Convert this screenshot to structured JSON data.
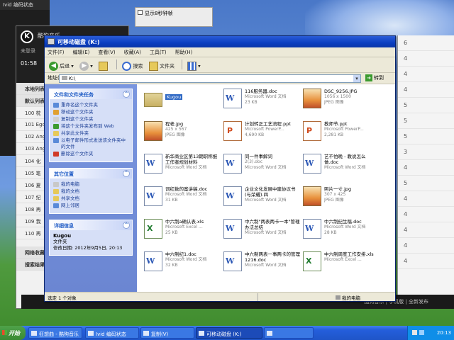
{
  "background": {
    "top_window_title": "Ivid 编码状态",
    "checkbox_label": "显示8秒钟帧",
    "music_app": {
      "title": "酷狗音乐",
      "user": "未登录",
      "time": "01:58",
      "rows": [
        "本地列表",
        "默认列表",
        "100 枕",
        "101 Ego",
        "102 Ang",
        "103 Ang",
        "104 化",
        "105 笔",
        "106 夏",
        "107 纪",
        "108 再",
        "109 我",
        "110 再"
      ],
      "footer_rows": [
        "网络收藏",
        "搜索结果"
      ]
    },
    "right_list": [
      "6",
      "4",
      "4",
      "4",
      "5",
      "5",
      "5",
      "3",
      "4",
      "5",
      "4",
      "4",
      "4",
      "4",
      "4"
    ],
    "strip_text": "酷狗音乐 | 手机版 | 全新发布"
  },
  "window": {
    "title": "可移动磁盘 (K:)",
    "menu": [
      "文件(F)",
      "编辑(E)",
      "查看(V)",
      "收藏(A)",
      "工具(T)",
      "帮助(H)"
    ],
    "toolbar": {
      "back": "后退",
      "search": "搜索",
      "folders": "文件夹"
    },
    "address": {
      "label": "地址(D)",
      "value": "K:\\",
      "go": "转到"
    },
    "tasks_panel": {
      "title": "文件和文件夹任务",
      "items": [
        "重命名这个文件夹",
        "移动这个文件夹",
        "复制这个文件夹",
        "将这个文件夹发布到 Web",
        "共享此文件夹",
        "以电子邮件形式发送该文件夹中的文件",
        "删除这个文件夹"
      ]
    },
    "places_panel": {
      "title": "其它位置",
      "items": [
        "我的电脑",
        "我的文档",
        "共享文档",
        "网上邻居"
      ]
    },
    "details_panel": {
      "title": "详细信息",
      "name": "Kugou",
      "type": "文件夹",
      "modified": "修改日期: 2012年9月5日, 20:13"
    },
    "files": [
      {
        "name": "Kugou",
        "kind": "folder",
        "l1": "",
        "l2": ""
      },
      {
        "name": "116服务器.doc",
        "kind": "word",
        "l1": "Microsoft Word 文档",
        "l2": "23 KB"
      },
      {
        "name": "DSC_9256.JPG",
        "kind": "jpg",
        "l1": "1056 x 1500",
        "l2": "JPEG 图像"
      },
      {
        "name": "程老.jpg",
        "kind": "jpg",
        "l1": "425 x 567",
        "l2": "JPEG 图像"
      },
      {
        "name": "计划转正工艺流程.ppt",
        "kind": "ppt",
        "l1": "Microsoft PowerP...",
        "l2": "4,690 KB"
      },
      {
        "name": "教师节.ppt",
        "kind": "ppt",
        "l1": "Microsoft PowerP...",
        "l2": "2,281 KB"
      },
      {
        "name": "新华商业区第13期职称报工作者规划材料",
        "kind": "word",
        "l1": "Microsoft Word 文档",
        "l2": ""
      },
      {
        "name": "同一件事解词",
        "kind": "word",
        "l1": "2(3).doc",
        "l2": "Microsoft Word 文档"
      },
      {
        "name": "艺不怕晚 - 教说怎么做.doc",
        "kind": "word",
        "l1": "Microsoft Word 文档",
        "l2": ""
      },
      {
        "name": "词红数的案讲稿.doc",
        "kind": "word",
        "l1": "Microsoft Word 文档",
        "l2": "31 KB"
      },
      {
        "name": "企业文化发展中建协议书(与荣耀).四",
        "kind": "word",
        "l1": "Microsoft Word 文档",
        "l2": ""
      },
      {
        "name": "照片一寸.jpg",
        "kind": "jpg",
        "l1": "307 x 425",
        "l2": "JPEG 图像"
      },
      {
        "name": "中六制a确认表.xls",
        "kind": "excel",
        "l1": "Microsoft Excel ...",
        "l2": "25 KB"
      },
      {
        "name": "中六制\"两表两卡一本\"管理办法总结",
        "kind": "word",
        "l1": "Microsoft Word 文档",
        "l2": ""
      },
      {
        "name": "中六制纪生稿.doc",
        "kind": "word",
        "l1": "Microsoft Word 文档",
        "l2": "28 KB"
      },
      {
        "name": "中六制纪1.doc",
        "kind": "word",
        "l1": "Microsoft Word 文档",
        "l2": "32 KB"
      },
      {
        "name": "中六制两表一事两卡的管理1216.doc",
        "kind": "word",
        "l1": "Microsoft Word 文档",
        "l2": ""
      },
      {
        "name": "中六制周度工作安排.xls",
        "kind": "excel",
        "l1": "Microsoft Excel ...",
        "l2": ""
      }
    ],
    "status": {
      "left": "选定 1 个对象",
      "right": "我的电脑"
    }
  },
  "taskbar": {
    "start": "开始",
    "tasks": [
      "狂想曲 - 酷狗音乐",
      "Ivid 编码状态",
      "复制(V)",
      "可移动磁盘 (K:)",
      ""
    ],
    "clock": "20:13"
  },
  "colors": {
    "title_blue": "#0a3ec0",
    "left_pane": "#7a96df",
    "taskbar_blue": "#245edb",
    "start_green": "#3a8a33"
  }
}
